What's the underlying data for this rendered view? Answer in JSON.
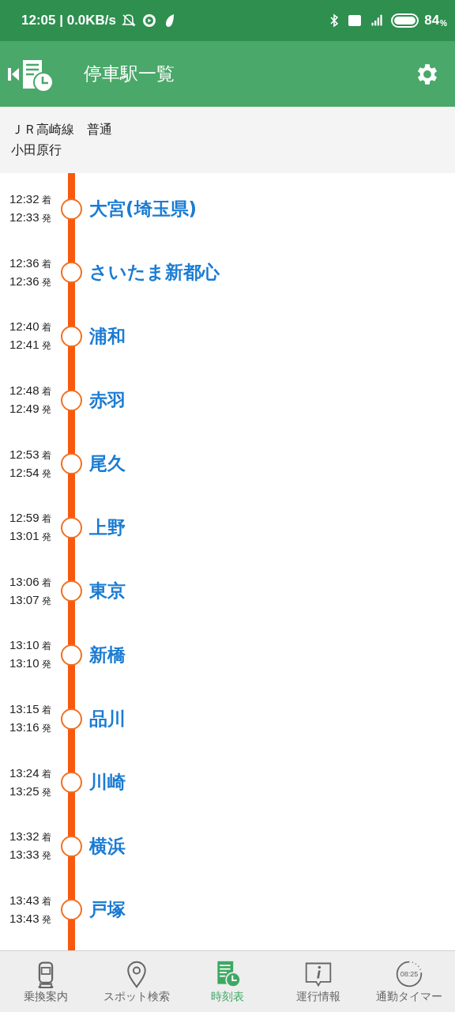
{
  "status_bar": {
    "time_speed": "12:05 | 0.0KB/s",
    "battery": "84",
    "percent": "%"
  },
  "header": {
    "title": "停車駅一覧"
  },
  "train": {
    "line": "ＪＲ高崎線　普通",
    "destination": "小田原行"
  },
  "stops": [
    {
      "arrive": "12:32",
      "arrive_mark": "着",
      "depart": "12:33",
      "depart_mark": "発",
      "station": "大宮(埼玉県)"
    },
    {
      "arrive": "12:36",
      "arrive_mark": "着",
      "depart": "12:36",
      "depart_mark": "発",
      "station": "さいたま新都心"
    },
    {
      "arrive": "12:40",
      "arrive_mark": "着",
      "depart": "12:41",
      "depart_mark": "発",
      "station": "浦和"
    },
    {
      "arrive": "12:48",
      "arrive_mark": "着",
      "depart": "12:49",
      "depart_mark": "発",
      "station": "赤羽"
    },
    {
      "arrive": "12:53",
      "arrive_mark": "着",
      "depart": "12:54",
      "depart_mark": "発",
      "station": "尾久"
    },
    {
      "arrive": "12:59",
      "arrive_mark": "着",
      "depart": "13:01",
      "depart_mark": "発",
      "station": "上野"
    },
    {
      "arrive": "13:06",
      "arrive_mark": "着",
      "depart": "13:07",
      "depart_mark": "発",
      "station": "東京"
    },
    {
      "arrive": "13:10",
      "arrive_mark": "着",
      "depart": "13:10",
      "depart_mark": "発",
      "station": "新橋"
    },
    {
      "arrive": "13:15",
      "arrive_mark": "着",
      "depart": "13:16",
      "depart_mark": "発",
      "station": "品川"
    },
    {
      "arrive": "13:24",
      "arrive_mark": "着",
      "depart": "13:25",
      "depart_mark": "発",
      "station": "川崎"
    },
    {
      "arrive": "13:32",
      "arrive_mark": "着",
      "depart": "13:33",
      "depart_mark": "発",
      "station": "横浜"
    },
    {
      "arrive": "13:43",
      "arrive_mark": "着",
      "depart": "13:43",
      "depart_mark": "発",
      "station": "戸塚"
    }
  ],
  "nav": [
    {
      "kind": "train",
      "label": "乗換案内",
      "selected": false
    },
    {
      "kind": "pin",
      "label": "スポット検索",
      "selected": false
    },
    {
      "kind": "timetable",
      "label": "時刻表",
      "selected": true
    },
    {
      "kind": "info",
      "label": "運行情報",
      "selected": false
    },
    {
      "kind": "timer",
      "label": "通勤タイマー",
      "selected": false,
      "icon_text": "08:25"
    }
  ]
}
